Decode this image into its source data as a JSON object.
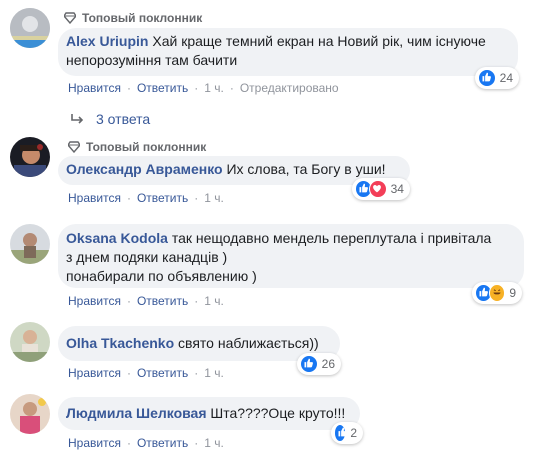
{
  "comments": [
    {
      "badge": "Топовый поклонник",
      "author": "Alex Uriupin",
      "text": "Хай краще темний екран на Новий рік, чим існуюче непорозуміння там бачити",
      "reactions": {
        "icons": [
          "like-icon"
        ],
        "count": "24"
      },
      "actions": {
        "like": "Нравится",
        "reply": "Ответить",
        "time": "1 ч.",
        "edited": "Отредактировано"
      }
    },
    {
      "replies": "3 ответа"
    },
    {
      "badge": "Топовый поклонник",
      "author": "Олександр Авраменко",
      "text": "Их слова, та Богу в уши!",
      "reactions": {
        "icons": [
          "like-icon",
          "love-icon"
        ],
        "count": "34"
      },
      "actions": {
        "like": "Нравится",
        "reply": "Ответить",
        "time": "1 ч."
      }
    },
    {
      "author": "Oksana Kodola",
      "text_lines": [
        "так нещодавно мендель переплутала і привітала",
        "з днем подяки канадців )",
        "понабирали по объявлению )"
      ],
      "reactions": {
        "icons": [
          "like-icon",
          "haha-icon"
        ],
        "count": "9"
      },
      "actions": {
        "like": "Нравится",
        "reply": "Ответить",
        "time": "1 ч."
      }
    },
    {
      "author": "Olha Tkachenko",
      "text": "свято наближається))",
      "reactions": {
        "icons": [
          "like-icon"
        ],
        "count": "26"
      },
      "actions": {
        "like": "Нравится",
        "reply": "Ответить",
        "time": "1 ч."
      }
    },
    {
      "author": "Людмила Шелковая",
      "text": "Шта????Оце круто!!!",
      "reactions": {
        "icons": [
          "like-icon"
        ],
        "count": "2"
      },
      "actions": {
        "like": "Нравится",
        "reply": "Ответить",
        "time": "1 ч."
      }
    }
  ],
  "colors": {
    "author": "#385898",
    "like": "#1877f2",
    "love": "#f33e58",
    "haha": "#f7b125",
    "bubble": "#f0f2f5"
  }
}
